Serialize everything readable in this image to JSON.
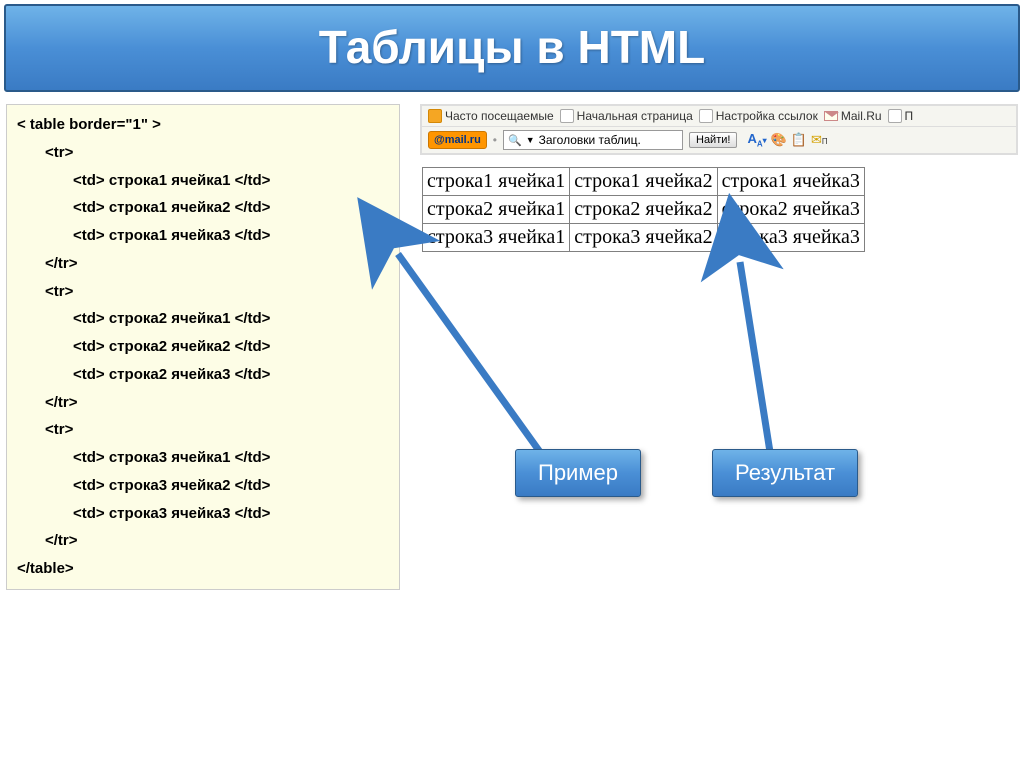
{
  "title": "Таблицы в HTML",
  "code": {
    "open_table": "< table border=\"1\" >",
    "tr_open": "<tr>",
    "tr_close": "</tr>",
    "td": {
      "r1c1": "<td> строка1 ячейка1 </td>",
      "r1c2": "<td> строка1 ячейка2 </td>",
      "r1c3": "<td> строка1 ячейка3 </td>",
      "r2c1": "<td> строка2 ячейка1 </td>",
      "r2c2": "<td> строка2 ячейка2 </td>",
      "r2c3": "<td> строка2 ячейка3 </td>",
      "r3c1": "<td> строка3 ячейка1 </td>",
      "r3c2": "<td> строка3 ячейка2 </td>",
      "r3c3": "<td> строка3 ячейка3 </td>"
    },
    "close_table": "</table>"
  },
  "bookmarks": {
    "frequent": "Часто посещаемые",
    "start": "Начальная страница",
    "links_setup": "Настройка ссылок",
    "mailru": "Mail.Ru",
    "p_suffix": "П"
  },
  "mail_logo": "@mail.ru",
  "search": {
    "text": "Заголовки таблиц.",
    "find": "Найти!"
  },
  "toolbar_icons": {
    "font": "A",
    "sub": "A",
    "paint": "🎨",
    "clip": "📋",
    "mail": "✉"
  },
  "table": {
    "rows": [
      [
        "строка1 ячейка1",
        "строка1 ячейка2",
        "строка1 ячейка3"
      ],
      [
        "строка2 ячейка1",
        "строка2 ячейка2",
        "строка2 ячейка3"
      ],
      [
        "строка3 ячейка1",
        "строка3 ячейка2",
        "строка3 ячейка3"
      ]
    ]
  },
  "callouts": {
    "example": "Пример",
    "result": "Результат"
  }
}
